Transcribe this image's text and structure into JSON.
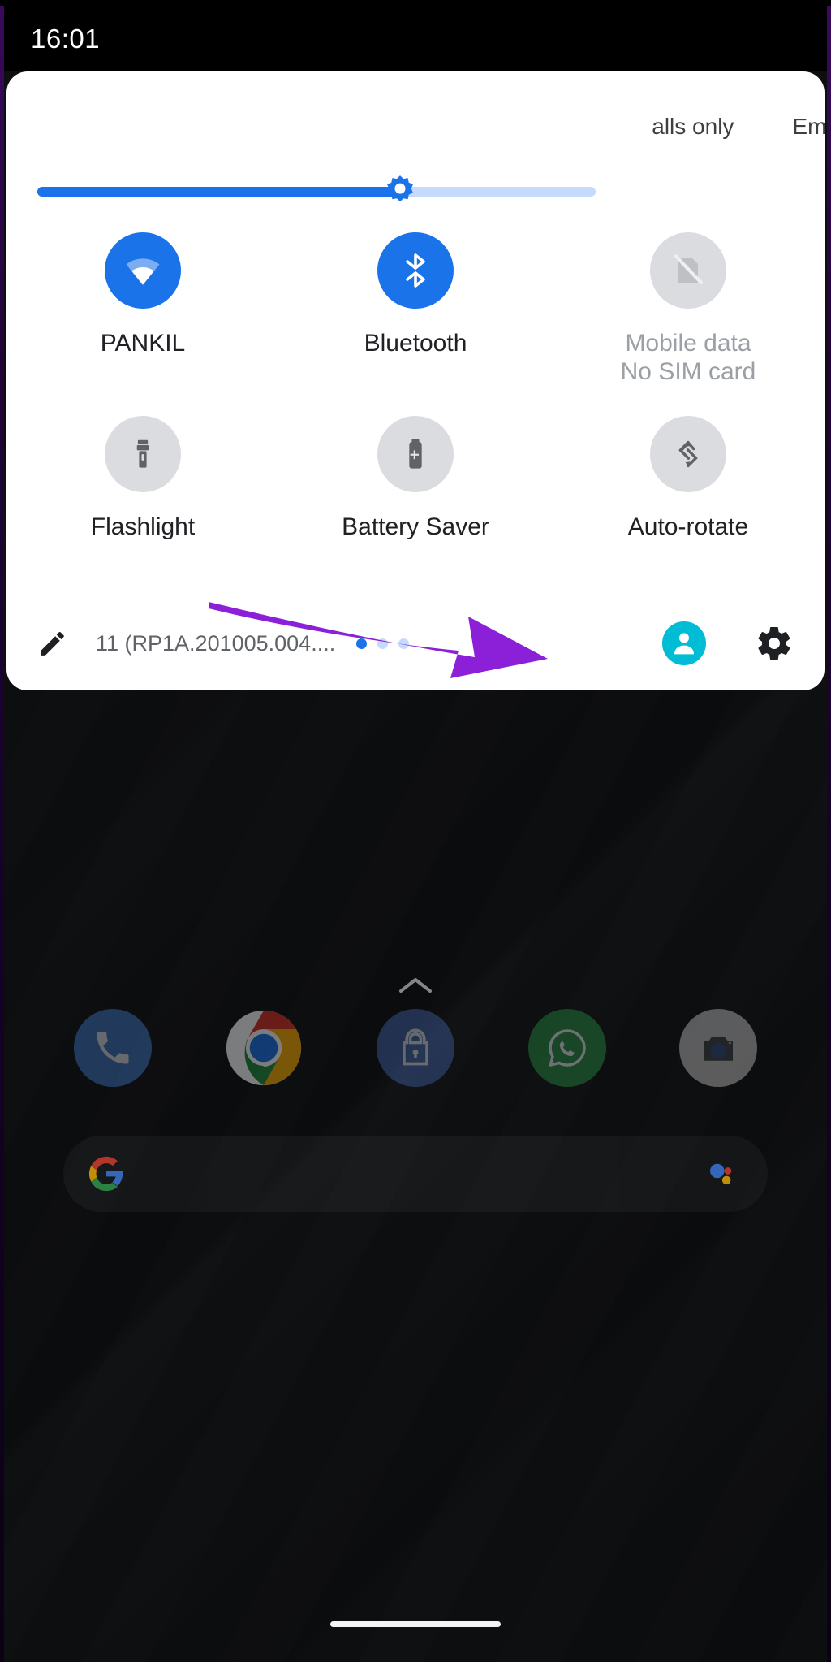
{
  "status_bar": {
    "clock": "16:01"
  },
  "quick_settings": {
    "carrier_primary": "alls only",
    "carrier_secondary": "Eme",
    "brightness": {
      "label": "Brightness",
      "value": 65,
      "fill_color": "#1a73e8",
      "track_color": "#c5dafc"
    },
    "tiles": [
      {
        "id": "wifi",
        "icon": "wifi-icon",
        "label": "PANKIL",
        "sub": "",
        "state": "on",
        "active_color": "#1a73e8"
      },
      {
        "id": "bluetooth",
        "icon": "bluetooth-icon",
        "label": "Bluetooth",
        "sub": "",
        "state": "on",
        "active_color": "#1a73e8"
      },
      {
        "id": "mobile-data",
        "icon": "sim-off-icon",
        "label": "Mobile data",
        "sub": "No SIM card",
        "state": "off",
        "active_color": "#dadce0"
      },
      {
        "id": "flashlight",
        "icon": "flashlight-icon",
        "label": "Flashlight",
        "sub": "",
        "state": "off",
        "active_color": "#dadce0"
      },
      {
        "id": "battery-saver",
        "icon": "battery-saver-icon",
        "label": "Battery Saver",
        "sub": "",
        "state": "off",
        "active_color": "#dadce0"
      },
      {
        "id": "auto-rotate",
        "icon": "auto-rotate-icon",
        "label": "Auto-rotate",
        "sub": "",
        "state": "off",
        "active_color": "#dadce0"
      }
    ],
    "footer": {
      "edit_icon": "pencil-icon",
      "build_text": "11 (RP1A.201005.004....",
      "page_dots": {
        "count": 3,
        "active_index": 0
      },
      "user_icon": "user-avatar-icon",
      "user_color": "#00bcd4",
      "settings_icon": "gear-icon"
    }
  },
  "annotation": {
    "type": "arrow",
    "color": "#8b20d8",
    "points_to": "user-avatar-icon"
  },
  "home_screen": {
    "app_drawer_chevron": "chevron-up-icon",
    "dock_apps": [
      {
        "id": "phone",
        "icon": "phone-icon",
        "color": "#3a6db5"
      },
      {
        "id": "chrome",
        "icon": "chrome-icon",
        "color": "#ffffff"
      },
      {
        "id": "vault",
        "icon": "lock-icon",
        "color": "#3f5e9e"
      },
      {
        "id": "whatsapp",
        "icon": "whatsapp-icon",
        "color": "#25d366"
      },
      {
        "id": "camera",
        "icon": "camera-icon",
        "color": "#b0b0b0"
      }
    ],
    "search": {
      "logo": "google-g-icon",
      "placeholder": "",
      "assistant_icon": "google-assistant-icon"
    }
  },
  "navigation": {
    "gesture_pill": "home-gesture-pill"
  }
}
